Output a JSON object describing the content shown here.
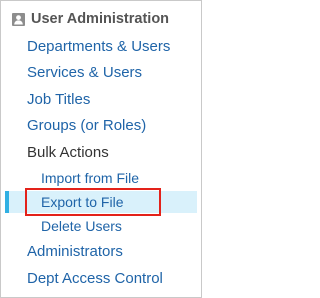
{
  "header": {
    "icon": "user-admin-icon",
    "title": "User Administration"
  },
  "menu": {
    "departments_users": "Departments & Users",
    "services_users": "Services & Users",
    "job_titles": "Job Titles",
    "groups_roles": "Groups (or Roles)",
    "bulk_actions": "Bulk Actions",
    "import_from_file": "Import from File",
    "export_to_file": "Export to File",
    "delete_users": "Delete Users",
    "administrators": "Administrators",
    "dept_access_control": "Dept Access Control"
  },
  "colors": {
    "link": "#1f64a8",
    "selected_background": "#d9f1fb",
    "selected_marker": "#31b0e3",
    "highlight_border": "#e3221a"
  },
  "selected_item": "Export to File"
}
